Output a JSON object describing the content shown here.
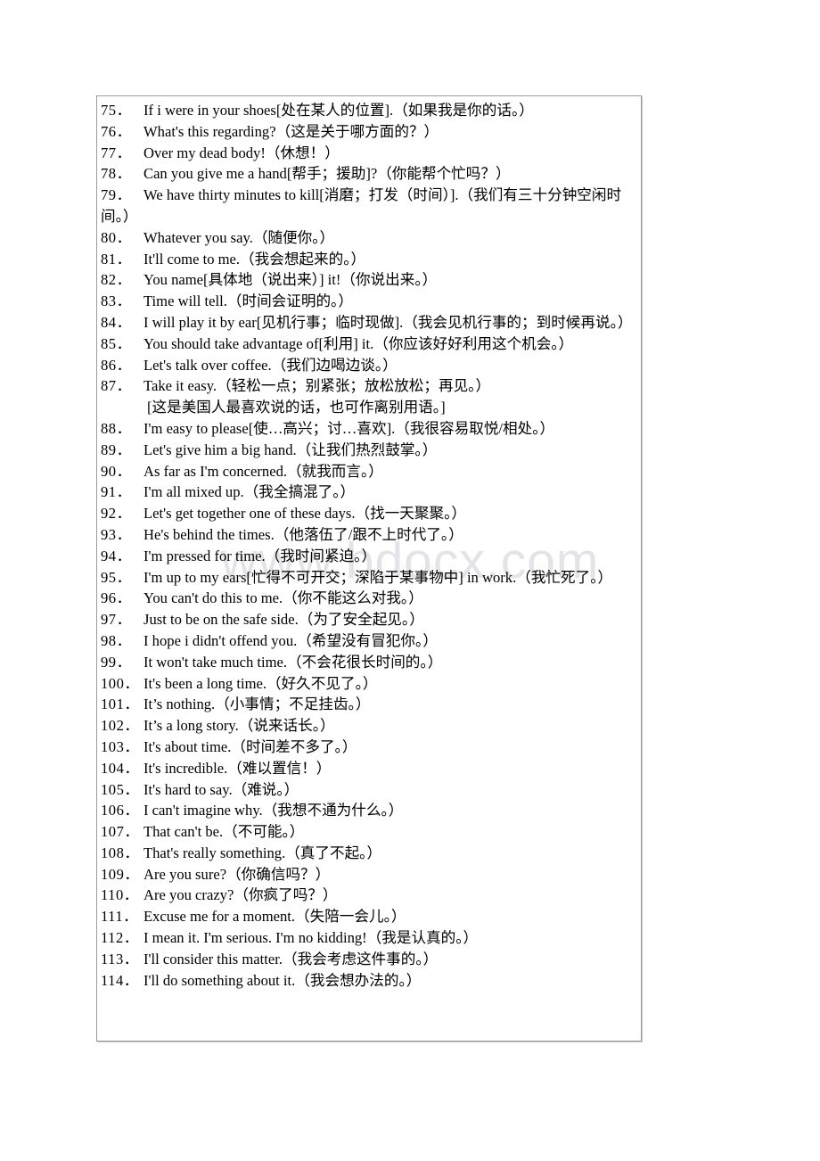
{
  "watermark": {
    "text": "www.bdocx.com"
  },
  "document": {
    "list": [
      {
        "number": "75．",
        "text": "If i were in your shoes[处在某人的位置].（如果我是你的话。）"
      },
      {
        "number": "76．",
        "text": "What's this regarding?（这是关于哪方面的？）"
      },
      {
        "number": "77．",
        "text": "Over my dead body!（休想！）"
      },
      {
        "number": "78．",
        "text": "Can you give me a hand[帮手；援助]?（你能帮个忙吗？）"
      },
      {
        "number": "79．",
        "text": "We have thirty minutes to kill[消磨；打发（时间）].（我们有三十分钟空闲时间。）"
      },
      {
        "number": "80．",
        "text": "Whatever you say.（随便你。）"
      },
      {
        "number": "81．",
        "text": "It'll come to me.（我会想起来的。）"
      },
      {
        "number": "82．",
        "text": "You name[具体地（说出来）] it!（你说出来。）"
      },
      {
        "number": "83．",
        "text": "Time will tell.（时间会证明的。）"
      },
      {
        "number": "84．",
        "text": "I will play it by ear[见机行事；临时现做].（我会见机行事的；到时候再说。）"
      },
      {
        "number": "85．",
        "text": "You should take advantage of[利用] it.（你应该好好利用这个机会。）"
      },
      {
        "number": "86．",
        "text": "Let's talk over coffee.（我们边喝边谈。）"
      },
      {
        "number": "87．",
        "text": "Take it easy.（轻松一点；别紧张；放松放松；再见。）",
        "note": "[这是美国人最喜欢说的话，也可作离别用语。]"
      },
      {
        "number": "88．",
        "text": "I'm easy to please[使…高兴；讨…喜欢].（我很容易取悦/相处。）"
      },
      {
        "number": "89．",
        "text": "Let's give him a big hand.（让我们热烈鼓掌。）"
      },
      {
        "number": "90．",
        "text": "As far as I'm concerned.（就我而言。）"
      },
      {
        "number": "91．",
        "text": "I'm all mixed up.（我全搞混了。）"
      },
      {
        "number": "92．",
        "text": "Let's get together one of these days.（找一天聚聚。）"
      },
      {
        "number": "93．",
        "text": "He's behind the times.（他落伍了/跟不上时代了。）"
      },
      {
        "number": "94．",
        "text": "I'm pressed for time.（我时间紧迫。）"
      },
      {
        "number": "95．",
        "text": "I'm up to my ears[忙得不可开交；深陷于某事物中] in work.（我忙死了。）"
      },
      {
        "number": "96．",
        "text": "You can't do this to me.（你不能这么对我。）"
      },
      {
        "number": "97．",
        "text": "Just to be on the safe side.（为了安全起见。）"
      },
      {
        "number": "98．",
        "text": "I hope i didn't offend you.（希望没有冒犯你。）"
      },
      {
        "number": "99．",
        "text": "It won't take much time.（不会花很长时间的。）"
      },
      {
        "number": "100．",
        "text": "It's been a long time.（好久不见了。）"
      },
      {
        "number": "101．",
        "text": "It’s nothing.（小事情；不足挂齿。）"
      },
      {
        "number": "102．",
        "text": "It’s a long story.（说来话长。）"
      },
      {
        "number": "103．",
        "text": "It's about time.（时间差不多了。）"
      },
      {
        "number": "104．",
        "text": "It's incredible.（难以置信！）"
      },
      {
        "number": "105．",
        "text": "It's hard to say.（难说。）"
      },
      {
        "number": "106．",
        "text": "I can't imagine why.（我想不通为什么。）"
      },
      {
        "number": "107．",
        "text": "That can't be.（不可能。）"
      },
      {
        "number": "108．",
        "text": "That's really something.（真了不起。）"
      },
      {
        "number": "109．",
        "text": "Are you sure?（你确信吗？）"
      },
      {
        "number": "110．",
        "text": "Are you crazy?（你疯了吗？）"
      },
      {
        "number": "111．",
        "text": "Excuse me for a moment.（失陪一会儿。）"
      },
      {
        "number": "112．",
        "text": "I mean it. I'm serious. I'm no kidding!（我是认真的。）"
      },
      {
        "number": "113．",
        "text": "I'll consider this matter.（我会考虑这件事的。）"
      },
      {
        "number": "114．",
        "text": "I'll do something about it.（我会想办法的。）"
      }
    ]
  }
}
